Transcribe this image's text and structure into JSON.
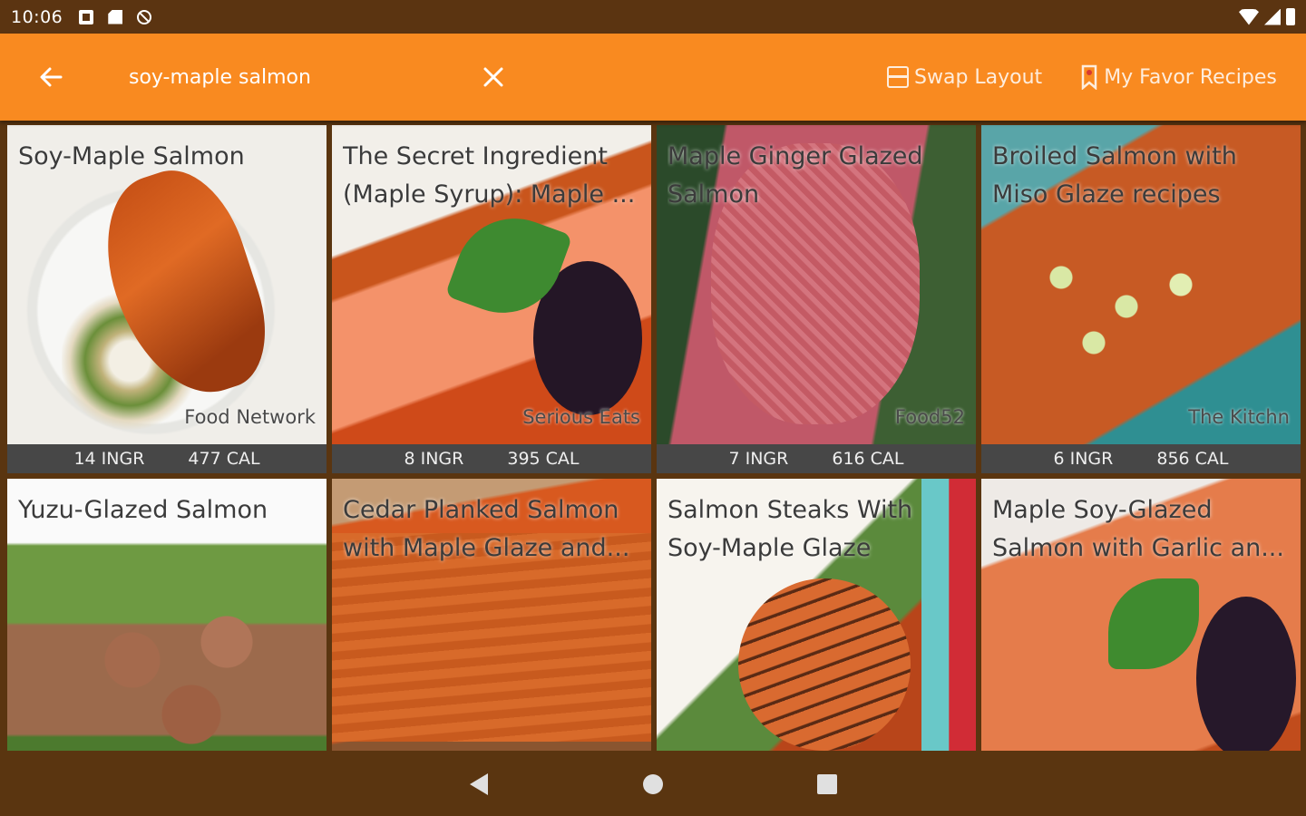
{
  "status_bar": {
    "time": "10:06"
  },
  "app_bar": {
    "search_value": "soy-maple salmon",
    "swap_layout_label": "Swap Layout",
    "favorites_label": "My Favor Recipes"
  },
  "recipes": [
    {
      "title": "Soy-Maple Salmon",
      "source": "Food Network",
      "ingr": "14 INGR",
      "cal": "477 CAL"
    },
    {
      "title": "The Secret Ingredient (Maple Syrup): Maple ...",
      "source": "Serious Eats",
      "ingr": "8 INGR",
      "cal": "395 CAL"
    },
    {
      "title": "Maple Ginger Glazed Salmon",
      "source": "Food52",
      "ingr": "7 INGR",
      "cal": "616 CAL"
    },
    {
      "title": "Broiled Salmon with Miso Glaze recipes",
      "source": "The Kitchn",
      "ingr": "6 INGR",
      "cal": "856 CAL"
    },
    {
      "title": "Yuzu-Glazed Salmon"
    },
    {
      "title": "Cedar Planked Salmon with Maple Glaze and..."
    },
    {
      "title": "Salmon Steaks With Soy-Maple Glaze"
    },
    {
      "title": "Maple Soy-Glazed Salmon with Garlic an..."
    }
  ],
  "colors": {
    "app_bar": "#f98a20",
    "system_bars": "#5a3510",
    "stats_bar": "#474747"
  }
}
